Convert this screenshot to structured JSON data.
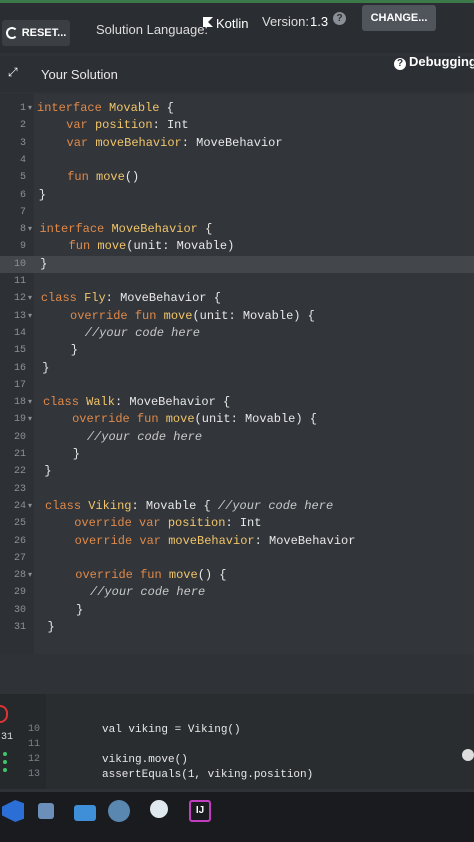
{
  "toolbar": {
    "reset_label": "RESET...",
    "language_label": "Solution Language:",
    "language_value": "Kotlin",
    "version_label": "Version:",
    "version_value": "1.3",
    "help_glyph": "?",
    "change_label": "CHANGE..."
  },
  "panel": {
    "title": "Your Solution",
    "debug_label": "Debugging",
    "expand_glyph": "⤢"
  },
  "colors": {
    "keyword": "#e08a4a",
    "function": "#f0c56a",
    "background": "#32353a"
  },
  "code_lines": [
    {
      "n": "1",
      "fold": "▾",
      "text": "interface Movable {"
    },
    {
      "n": "2",
      "text": "    var position: Int"
    },
    {
      "n": "3",
      "text": "    var moveBehavior: MoveBehavior"
    },
    {
      "n": "4",
      "text": ""
    },
    {
      "n": "5",
      "text": "    fun move()"
    },
    {
      "n": "6",
      "text": "}"
    },
    {
      "n": "7",
      "text": ""
    },
    {
      "n": "8",
      "fold": "▾",
      "text": "interface MoveBehavior {"
    },
    {
      "n": "9",
      "text": "    fun move(unit: Movable)"
    },
    {
      "n": "10",
      "text": "}"
    },
    {
      "n": "11",
      "text": ""
    },
    {
      "n": "12",
      "fold": "▾",
      "text": "class Fly: MoveBehavior {"
    },
    {
      "n": "13",
      "fold": "▾",
      "text": "    override fun move(unit: Movable) {"
    },
    {
      "n": "14",
      "text": "      //your code here"
    },
    {
      "n": "15",
      "text": "    }"
    },
    {
      "n": "16",
      "text": "}"
    },
    {
      "n": "17",
      "text": ""
    },
    {
      "n": "18",
      "fold": "▾",
      "text": "class Walk: MoveBehavior {"
    },
    {
      "n": "19",
      "fold": "▾",
      "text": "    override fun move(unit: Movable) {"
    },
    {
      "n": "20",
      "text": "      //your code here"
    },
    {
      "n": "21",
      "text": "    }"
    },
    {
      "n": "22",
      "text": "}"
    },
    {
      "n": "23",
      "text": ""
    },
    {
      "n": "24",
      "fold": "▾",
      "text": "class Viking: Movable { //your code here"
    },
    {
      "n": "25",
      "text": "    override var position: Int"
    },
    {
      "n": "26",
      "text": "    override var moveBehavior: MoveBehavior"
    },
    {
      "n": "27",
      "text": ""
    },
    {
      "n": "28",
      "fold": "▾",
      "text": "    override fun move() {"
    },
    {
      "n": "29",
      "text": "      //your code here"
    },
    {
      "n": "30",
      "text": "    }"
    },
    {
      "n": "31",
      "text": "}"
    }
  ],
  "test_lines": [
    {
      "n": "10",
      "text": "val viking = Viking()"
    },
    {
      "n": "11",
      "text": ""
    },
    {
      "n": "12",
      "text": "viking.move()"
    },
    {
      "n": "13",
      "text": "assertEquals(1, viking.position)"
    }
  ],
  "side": {
    "line_ref": "31"
  },
  "taskbar": {
    "intellij_label": "IJ"
  }
}
